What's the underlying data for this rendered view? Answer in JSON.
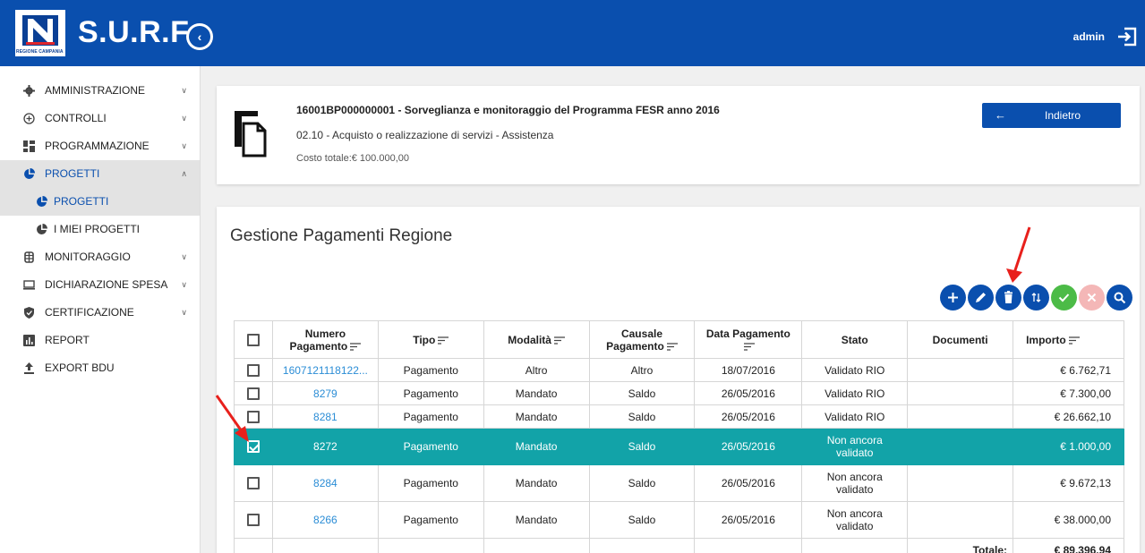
{
  "header": {
    "logo_caption": "REGIONE CAMPANIA",
    "app_title": "S.U.R.F.",
    "user": "admin",
    "brand_color": "#0a4fae"
  },
  "sidebar": {
    "items": [
      {
        "label": "AMMINISTRAZIONE",
        "icon": "gear-icon"
      },
      {
        "label": "CONTROLLI",
        "icon": "plus-circle-icon"
      },
      {
        "label": "PROGRAMMAZIONE",
        "icon": "grid-icon"
      },
      {
        "label": "PROGETTI",
        "icon": "pie-icon"
      },
      {
        "label": "PROGETTI",
        "icon": "pie-icon"
      },
      {
        "label": "I MIEI PROGETTI",
        "icon": "pie-icon"
      },
      {
        "label": "MONITORAGGIO",
        "icon": "monitor-icon"
      },
      {
        "label": "DICHIARAZIONE SPESA",
        "icon": "laptop-icon"
      },
      {
        "label": "CERTIFICAZIONE",
        "icon": "shield-icon"
      },
      {
        "label": "REPORT",
        "icon": "bar-chart-icon"
      },
      {
        "label": "EXPORT BDU",
        "icon": "upload-icon"
      }
    ]
  },
  "project": {
    "title": "16001BP000000001 - Sorveglianza e monitoraggio del Programma FESR anno 2016",
    "subtitle": "02.10 - Acquisto o realizzazione di servizi - Assistenza",
    "cost": "Costo totale:€ 100.000,00",
    "back_label": "Indietro"
  },
  "payments": {
    "title": "Gestione Pagamenti Regione",
    "actions": [
      "add-button",
      "edit-button",
      "delete-button",
      "sort-button",
      "approve-button",
      "reject-button",
      "search-button"
    ],
    "columns": {
      "numero_1": "Numero",
      "numero_2": "Pagamento",
      "tipo": "Tipo",
      "modalita": "Modalità",
      "causale_1": "Causale",
      "causale_2": "Pagamento",
      "data_1": "Data Pagamento",
      "stato": "Stato",
      "documenti": "Documenti",
      "importo": "Importo"
    },
    "rows": [
      {
        "numero": "1607121118122...",
        "tipo": "Pagamento",
        "modalita": "Altro",
        "causale": "Altro",
        "data": "18/07/2016",
        "stato": "Validato RIO",
        "documenti": "",
        "importo": "€ 6.762,71"
      },
      {
        "numero": "8279",
        "tipo": "Pagamento",
        "modalita": "Mandato",
        "causale": "Saldo",
        "data": "26/05/2016",
        "stato": "Validato RIO",
        "documenti": "",
        "importo": "€ 7.300,00"
      },
      {
        "numero": "8281",
        "tipo": "Pagamento",
        "modalita": "Mandato",
        "causale": "Saldo",
        "data": "26/05/2016",
        "stato": "Validato RIO",
        "documenti": "",
        "importo": "€ 26.662,10"
      },
      {
        "numero": "8272",
        "tipo": "Pagamento",
        "modalita": "Mandato",
        "causale": "Saldo",
        "data": "26/05/2016",
        "stato": "Non ancora validato",
        "documenti": "",
        "importo": "€ 1.000,00"
      },
      {
        "numero": "8284",
        "tipo": "Pagamento",
        "modalita": "Mandato",
        "causale": "Saldo",
        "data": "26/05/2016",
        "stato": "Non ancora validato",
        "documenti": "",
        "importo": "€ 9.672,13"
      },
      {
        "numero": "8266",
        "tipo": "Pagamento",
        "modalita": "Mandato",
        "causale": "Saldo",
        "data": "26/05/2016",
        "stato": "Non ancora validato",
        "documenti": "",
        "importo": "€ 38.000,00"
      }
    ],
    "total_label": "Totale:",
    "total_value": "€ 89.396,94",
    "selected_color": "#12a3a8"
  }
}
